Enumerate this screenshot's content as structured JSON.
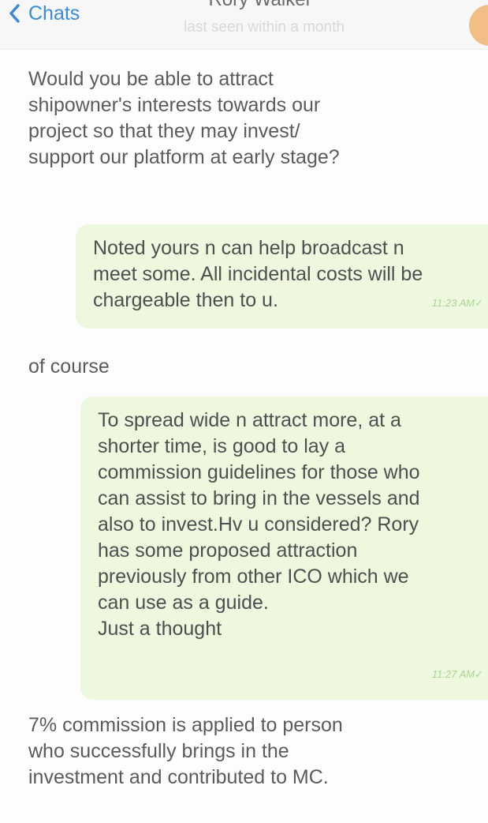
{
  "header": {
    "back_label": "Chats",
    "contact_name": "Rory Walker",
    "status": "last seen within a month"
  },
  "messages": [
    {
      "direction": "incoming",
      "text": "Would you be able to attract\nshipowner's interests towards our\nproject so that they may invest/\nsupport our platform at early stage?"
    },
    {
      "direction": "outgoing",
      "text": "Noted yours n can help broadcast n\nmeet some. All incidental costs will be\nchargeable then to u.",
      "time": "11:23 AM"
    },
    {
      "direction": "incoming",
      "text": "of course"
    },
    {
      "direction": "outgoing",
      "text": "To spread wide n attract more, at a\nshorter time, is good to lay a\ncommission guidelines for those who\ncan assist to bring in the vessels and\nalso to invest.Hv u considered? Rory\nhas some proposed attraction\npreviously from other ICO which we\ncan use as a guide.\nJust a thought",
      "time": "11:27 AM"
    },
    {
      "direction": "incoming",
      "text": "7% commission is applied to person\nwho successfully brings in the\ninvestment and contributed to MC."
    }
  ],
  "colors": {
    "accent": "#3a8ad8",
    "outgoing_bubble": "#edf8de",
    "time_text": "#a9d691",
    "incoming_text": "#5b5b5b",
    "avatar": "#f3be85"
  },
  "icons": {
    "back": "chevron-left-icon",
    "read_status": "check-icon"
  }
}
